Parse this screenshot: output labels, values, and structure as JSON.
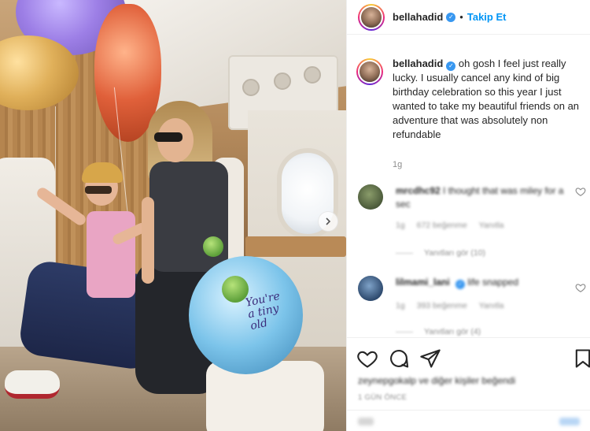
{
  "post": {
    "username": "bellahadid",
    "verified_icon": "verified-badge-icon",
    "follow_label": "Takip Et",
    "caption": "oh gosh I feel just really lucky. I usually cancel any kind of big birthday celebration so this year I just wanted to take my beautiful friends on an adventure that was absolutely non refundable",
    "caption_time": "1g",
    "colors": {
      "accent": "#0095f6",
      "verified": "#3897f0",
      "text": "#262626",
      "muted": "#8e8e8e"
    }
  },
  "media": {
    "balloon_print": "You're\na tiny\nold",
    "next_icon": "chevron-right-icon"
  },
  "comments": [
    {
      "username": "mrcdhc92",
      "text": "I thought that was miley for a sec",
      "time": "1g",
      "likes": "672 beğenme",
      "reply_label": "Yanıtla",
      "view_replies": "Yanıtları gör (10)"
    },
    {
      "username": "lilmami_lani",
      "text": "life snapped",
      "time": "1g",
      "likes": "393 beğenme",
      "reply_label": "Yanıtla",
      "view_replies": "Yanıtları gör (4)"
    }
  ],
  "actions": {
    "like_icon": "heart-icon",
    "comment_icon": "comment-icon",
    "share_icon": "paper-plane-icon",
    "save_icon": "bookmark-icon"
  },
  "liked_by": "zeynepgokalp ve diğer kişiler beğendi",
  "posted_ago": "1 GÜN ÖNCE"
}
